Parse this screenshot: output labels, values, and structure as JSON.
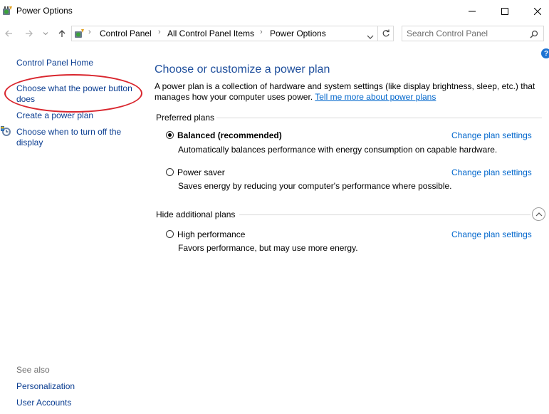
{
  "window": {
    "title": "Power Options",
    "controls": {
      "minimize": "—",
      "maximize": "☐",
      "close": "✕"
    }
  },
  "navigation": {
    "breadcrumb": [
      "Control Panel",
      "All Control Panel Items",
      "Power Options"
    ],
    "search_placeholder": "Search Control Panel"
  },
  "sidebar": {
    "home": "Control Panel Home",
    "tasks": [
      {
        "label": "Choose what the power button",
        "label2": "does"
      },
      {
        "label": "Create a power plan"
      },
      {
        "label": "Choose when to turn off the",
        "label2": "display"
      }
    ],
    "see_also_heading": "See also",
    "see_also": [
      "Personalization",
      "User Accounts"
    ]
  },
  "main": {
    "heading": "Choose or customize a power plan",
    "intro_line1": "A power plan is a collection of hardware and system settings (like display brightness, sleep, etc.) that",
    "intro_line2": "manages how your computer uses power.",
    "intro_link": "Tell me more about power plans",
    "preferred_heading": "Preferred plans",
    "hide_heading": "Hide additional plans",
    "plans": [
      {
        "name": "Balanced (recommended)",
        "description": "Automatically balances performance with energy consumption on capable hardware.",
        "selected": true,
        "action": "Change plan settings"
      },
      {
        "name": "Power saver",
        "description": "Saves energy by reducing your computer's performance where possible.",
        "selected": false,
        "action": "Change plan settings"
      },
      {
        "name": "High performance",
        "description": "Favors performance, but may use more energy.",
        "selected": false,
        "action": "Change plan settings"
      }
    ]
  },
  "colors": {
    "link": "#0a3d91",
    "heading": "#1e4e9c",
    "annotation": "#d9262e"
  },
  "icons": [
    "power-options-icon",
    "back-icon",
    "forward-icon",
    "recent-icon",
    "up-icon",
    "dropdown-icon",
    "refresh-icon",
    "search-icon",
    "help-icon",
    "shield-icon",
    "collapse-icon"
  ]
}
